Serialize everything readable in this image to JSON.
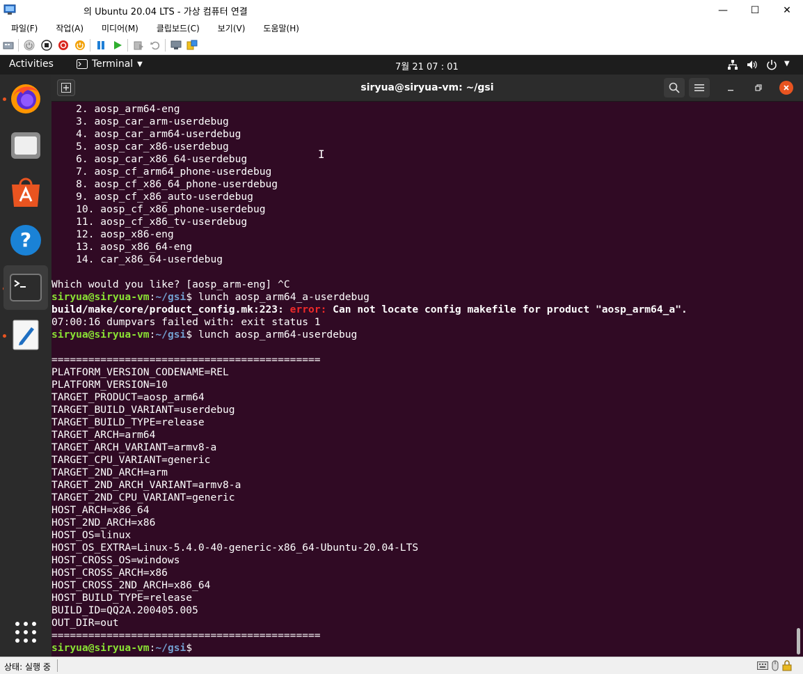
{
  "host_window": {
    "title": "의 Ubuntu 20.04 LTS - 가상 컴퓨터 연결",
    "controls": {
      "minimize": "—",
      "maximize": "☐",
      "close": "✕"
    }
  },
  "menubar": {
    "items": [
      {
        "label": "파일(F)"
      },
      {
        "label": "작업(A)"
      },
      {
        "label": "미디어(M)"
      },
      {
        "label": "클립보드(C)"
      },
      {
        "label": "보기(V)"
      },
      {
        "label": "도움말(H)"
      }
    ]
  },
  "toolbar": {
    "icons": [
      "ctrl-alt-del-icon",
      "start-icon",
      "turn-off-icon",
      "shutdown-icon",
      "save-icon",
      "pause-icon",
      "resume-icon",
      "checkpoint-icon",
      "revert-icon",
      "enhanced-session-icon",
      "share-icon"
    ]
  },
  "ubuntu_topbar": {
    "activities": "Activities",
    "app_menu": "Terminal",
    "clock": "7월 21  07 : 01"
  },
  "dock": {
    "items": [
      {
        "name": "firefox",
        "running": true
      },
      {
        "name": "files",
        "running": false
      },
      {
        "name": "software",
        "running": false
      },
      {
        "name": "help",
        "running": false
      },
      {
        "name": "terminal",
        "running": true,
        "active": true
      },
      {
        "name": "text-editor",
        "running": true
      }
    ]
  },
  "terminal": {
    "title": "siryua@siryua-vm: ~/gsi",
    "lines": [
      [
        {
          "t": "    2. aosp_arm64-eng"
        }
      ],
      [
        {
          "t": "    3. aosp_car_arm-userdebug"
        }
      ],
      [
        {
          "t": "    4. aosp_car_arm64-userdebug"
        }
      ],
      [
        {
          "t": "    5. aosp_car_x86-userdebug"
        }
      ],
      [
        {
          "t": "    6. aosp_car_x86_64-userdebug"
        }
      ],
      [
        {
          "t": "    7. aosp_cf_arm64_phone-userdebug"
        }
      ],
      [
        {
          "t": "    8. aosp_cf_x86_64_phone-userdebug"
        }
      ],
      [
        {
          "t": "    9. aosp_cf_x86_auto-userdebug"
        }
      ],
      [
        {
          "t": "    10. aosp_cf_x86_phone-userdebug"
        }
      ],
      [
        {
          "t": "    11. aosp_cf_x86_tv-userdebug"
        }
      ],
      [
        {
          "t": "    12. aosp_x86-eng"
        }
      ],
      [
        {
          "t": "    13. aosp_x86_64-eng"
        }
      ],
      [
        {
          "t": "    14. car_x86_64-userdebug"
        }
      ],
      [
        {
          "t": ""
        }
      ],
      [
        {
          "t": "Which would you like? [aosp_arm-eng] ^C"
        }
      ],
      [
        {
          "t": "siryua@siryua-vm",
          "c": "prompt-user"
        },
        {
          "t": ":"
        },
        {
          "t": "~/gsi",
          "c": "prompt-path"
        },
        {
          "t": "$ lunch aosp_arm64_a-userdebug"
        }
      ],
      [
        {
          "t": "build/make/core/product_config.mk:223: ",
          "c": "bold"
        },
        {
          "t": "error:",
          "c": "err"
        },
        {
          "t": " Can not locate config makefile for product \"aosp_arm64_a\".",
          "c": "bold"
        }
      ],
      [
        {
          "t": "07:00:16 dumpvars failed with: exit status 1"
        }
      ],
      [
        {
          "t": "siryua@siryua-vm",
          "c": "prompt-user"
        },
        {
          "t": ":"
        },
        {
          "t": "~/gsi",
          "c": "prompt-path"
        },
        {
          "t": "$ lunch aosp_arm64-userdebug"
        }
      ],
      [
        {
          "t": ""
        }
      ],
      [
        {
          "t": "============================================"
        }
      ],
      [
        {
          "t": "PLATFORM_VERSION_CODENAME=REL"
        }
      ],
      [
        {
          "t": "PLATFORM_VERSION=10"
        }
      ],
      [
        {
          "t": "TARGET_PRODUCT=aosp_arm64"
        }
      ],
      [
        {
          "t": "TARGET_BUILD_VARIANT=userdebug"
        }
      ],
      [
        {
          "t": "TARGET_BUILD_TYPE=release"
        }
      ],
      [
        {
          "t": "TARGET_ARCH=arm64"
        }
      ],
      [
        {
          "t": "TARGET_ARCH_VARIANT=armv8-a"
        }
      ],
      [
        {
          "t": "TARGET_CPU_VARIANT=generic"
        }
      ],
      [
        {
          "t": "TARGET_2ND_ARCH=arm"
        }
      ],
      [
        {
          "t": "TARGET_2ND_ARCH_VARIANT=armv8-a"
        }
      ],
      [
        {
          "t": "TARGET_2ND_CPU_VARIANT=generic"
        }
      ],
      [
        {
          "t": "HOST_ARCH=x86_64"
        }
      ],
      [
        {
          "t": "HOST_2ND_ARCH=x86"
        }
      ],
      [
        {
          "t": "HOST_OS=linux"
        }
      ],
      [
        {
          "t": "HOST_OS_EXTRA=Linux-5.4.0-40-generic-x86_64-Ubuntu-20.04-LTS"
        }
      ],
      [
        {
          "t": "HOST_CROSS_OS=windows"
        }
      ],
      [
        {
          "t": "HOST_CROSS_ARCH=x86"
        }
      ],
      [
        {
          "t": "HOST_CROSS_2ND_ARCH=x86_64"
        }
      ],
      [
        {
          "t": "HOST_BUILD_TYPE=release"
        }
      ],
      [
        {
          "t": "BUILD_ID=QQ2A.200405.005"
        }
      ],
      [
        {
          "t": "OUT_DIR=out"
        }
      ],
      [
        {
          "t": "============================================"
        }
      ],
      [
        {
          "t": "siryua@siryua-vm",
          "c": "prompt-user"
        },
        {
          "t": ":"
        },
        {
          "t": "~/gsi",
          "c": "prompt-path"
        },
        {
          "t": "$ "
        }
      ]
    ]
  },
  "statusbar": {
    "status": "상태: 실행 중"
  },
  "colors": {
    "terminal_bg": "#300a24",
    "prompt_user": "#8ae234",
    "prompt_path": "#729fcf",
    "error": "#ef2929",
    "ubuntu_orange": "#e95420"
  }
}
